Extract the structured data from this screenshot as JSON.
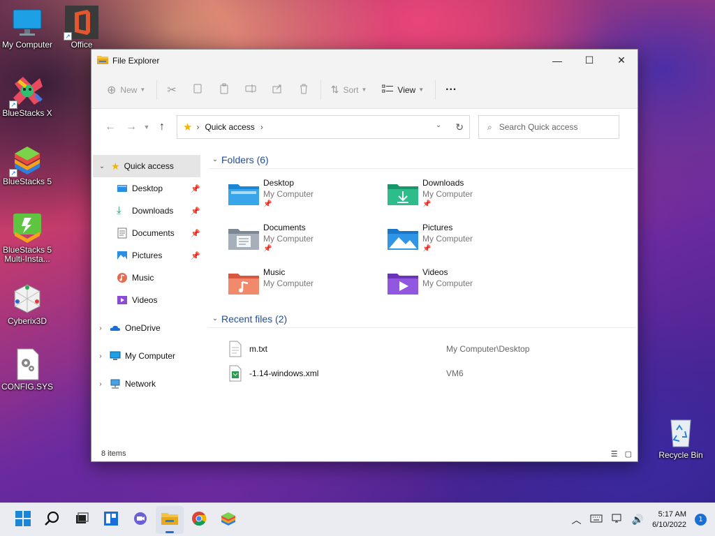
{
  "desktop": {
    "icons": [
      {
        "label": "My Computer"
      },
      {
        "label": "Office"
      },
      {
        "label": "BlueStacks X"
      },
      {
        "label": "BlueStacks 5"
      },
      {
        "label": "BlueStacks 5 Multi-Insta..."
      },
      {
        "label": "Cyberix3D"
      },
      {
        "label": "CONFIG.SYS"
      },
      {
        "label": "Recycle Bin"
      }
    ]
  },
  "window": {
    "title": "File Explorer",
    "controls": {
      "minimize": "—",
      "maximize": "☐",
      "close": "✕"
    }
  },
  "toolbar": {
    "new_label": "New",
    "sort_label": "Sort",
    "view_label": "View",
    "more_label": "···"
  },
  "address": {
    "path": "Quick access",
    "search_placeholder": "Search Quick access"
  },
  "nav": {
    "quick_access": "Quick access",
    "pinned": [
      {
        "label": "Desktop",
        "pinned": true
      },
      {
        "label": "Downloads",
        "pinned": true
      },
      {
        "label": "Documents",
        "pinned": true
      },
      {
        "label": "Pictures",
        "pinned": true
      },
      {
        "label": "Music",
        "pinned": false
      },
      {
        "label": "Videos",
        "pinned": false
      }
    ],
    "onedrive": "OneDrive",
    "my_computer": "My Computer",
    "network": "Network"
  },
  "folders_section": {
    "title": "Folders (6)",
    "items": [
      {
        "name": "Desktop",
        "location": "My Computer",
        "pinned": true
      },
      {
        "name": "Downloads",
        "location": "My Computer",
        "pinned": true
      },
      {
        "name": "Documents",
        "location": "My Computer",
        "pinned": true
      },
      {
        "name": "Pictures",
        "location": "My Computer",
        "pinned": true
      },
      {
        "name": "Music",
        "location": "My Computer",
        "pinned": false
      },
      {
        "name": "Videos",
        "location": "My Computer",
        "pinned": false
      }
    ]
  },
  "recent_section": {
    "title": "Recent files (2)",
    "items": [
      {
        "name": "m.txt",
        "location": "My Computer\\Desktop"
      },
      {
        "name": "-1.14-windows.xml",
        "location": "VM6"
      }
    ]
  },
  "status": {
    "item_count": "8 items"
  },
  "taskbar": {
    "time": "5:17 AM",
    "date": "6/10/2022",
    "notifications": "1"
  },
  "colors": {
    "accent": "#1a6fd6",
    "section_title": "#1f4e9a"
  }
}
